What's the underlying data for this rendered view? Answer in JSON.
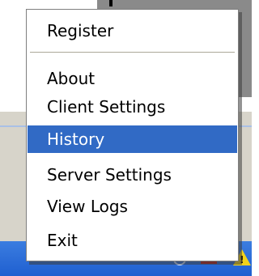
{
  "menu": {
    "top_items": [
      {
        "label": "Register"
      }
    ],
    "items": [
      {
        "label": "About"
      },
      {
        "label": "Client Settings"
      },
      {
        "label": "History",
        "selected": true
      },
      {
        "label": "Server Settings"
      },
      {
        "label": "View Logs"
      },
      {
        "label": "Exit"
      }
    ]
  },
  "colors": {
    "menu_background": "#ffffff",
    "selection": "#316ac5",
    "selection_text": "#ffffff",
    "taskbar": "#2a68d8"
  },
  "tray": {
    "icons": [
      "network-icon",
      "volume-icon",
      "status-circle-icon",
      "red-app-icon",
      "warning-icon"
    ]
  }
}
